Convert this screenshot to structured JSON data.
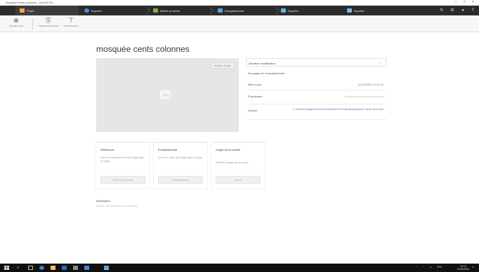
{
  "titlebar": {
    "title": "mosquée cents colonnes - ArcGIS Pro",
    "minimize": "–",
    "maximize": "□",
    "close": "×"
  },
  "nav": {
    "items": [
      {
        "label": "Projet",
        "icon": "folder-icon",
        "color": "#f0a930"
      },
      {
        "label": "Explorer",
        "icon": "explore-icon",
        "color": "#4a90d9"
      },
      {
        "label": "Mettre en forme",
        "icon": "style-icon",
        "color": "#7fb24a"
      },
      {
        "label": "Enregistrement",
        "icon": "save-icon",
        "color": "#5aa0e0"
      },
      {
        "label": "Exporter",
        "icon": "export-icon",
        "color": "#66b3e6"
      },
      {
        "label": "Importer",
        "icon": "import-icon",
        "color": "#7ab8e8"
      }
    ],
    "right_icons": [
      "refresh-icon",
      "settings-icon",
      "user-icon",
      "help-icon"
    ]
  },
  "ribbon": {
    "buttons": [
      {
        "label": "Nouveau projet",
        "icon": "new-project-icon"
      },
      {
        "label": "Charger des données",
        "icon": "load-data-icon"
      },
      {
        "label": "Nouvel élément",
        "icon": "new-item-icon"
      }
    ]
  },
  "page": {
    "title": "mosquée cents colonnes",
    "preview_button": "Modifier l'image"
  },
  "info": {
    "header": "Dernière modification",
    "subheader": "Nb pages de l'enregistrement",
    "rows": [
      {
        "key": "Mise à jour",
        "value": "11/10/2020 12:12:04"
      },
      {
        "key": "Propriétaire",
        "value": "Modifications sont enregistrées"
      },
      {
        "key": "Dossier",
        "value": "C:\\Users\\mosquée\\Documents\\ArcGIS\\Projects\\mosquée cents colonnes"
      }
    ]
  },
  "cards": [
    {
      "title": "Référencer",
      "desc": "Ouvre le référencement de l'image dans ce projet.",
      "button": "Référencer l'image"
    },
    {
      "title": "Enregistrement",
      "desc": "Crée une copie de l'image dans le projet.",
      "button": "Enregistrement"
    },
    {
      "title": "Usage de la couche",
      "desc": "Effectuer l'usage de la couche.",
      "button": "Ouvrir"
    }
  ],
  "description": {
    "title": "Description",
    "text": "Ajoutez une description pour ce projet"
  },
  "taskbar": {
    "tray": "FRA",
    "time": "12:12",
    "date": "11/10/2020"
  }
}
